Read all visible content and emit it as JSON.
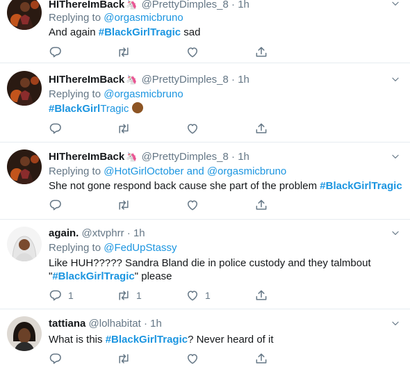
{
  "tweets": [
    {
      "name": "HIThereImBack",
      "handle": "@PrettyDimples_8",
      "time": "1h",
      "replying_label": "Replying to",
      "replying_to": "@orgasmicbruno",
      "body_pre": "And again ",
      "hashtag": "#BlackGirlTragic",
      "body_post": " sad",
      "reply_count": "",
      "retweet_count": "",
      "like_count": ""
    },
    {
      "name": "HIThereImBack",
      "handle": "@PrettyDimples_8",
      "time": "1h",
      "replying_label": "Replying to",
      "replying_to": "@orgasmicbruno",
      "hashtag_bold": "#BlackGirl",
      "hashtag_plain": "Tragic",
      "reply_count": "",
      "retweet_count": "",
      "like_count": ""
    },
    {
      "name": "HIThereImBack",
      "handle": "@PrettyDimples_8",
      "time": "1h",
      "replying_label": "Replying to",
      "replying_to": "@HotGirlOctober and @orgasmicbruno",
      "body_pre": "She not gone respond back cause she part of the problem ",
      "hashtag": "#BlackGirlTragic",
      "reply_count": "",
      "retweet_count": "",
      "like_count": ""
    },
    {
      "name": "again.",
      "handle": "@xtvphrr",
      "time": "1h",
      "replying_label": "Replying to",
      "replying_to": "@FedUpStassy",
      "body_line1": "Like HUH????? Sandra Bland die in police custody and they talmbout",
      "quote_open": "\"",
      "hashtag": "#BlackGirlTragic",
      "quote_close": "\" please",
      "reply_count": "1",
      "retweet_count": "1",
      "like_count": "1"
    },
    {
      "name": "tattiana",
      "handle": "@lolhabitat",
      "time": "1h",
      "body_pre": "What is this ",
      "hashtag": "#BlackGirlTragic",
      "body_post": "? Never heard of it",
      "reply_count": "",
      "retweet_count": "",
      "like_count": ""
    }
  ],
  "separator": "·",
  "icons": [
    "reply-icon",
    "retweet-icon",
    "like-icon",
    "share-icon",
    "caret-down-icon",
    "unicorn-emoji",
    "facepalm-emoji"
  ],
  "colors": {
    "link": "#1b95e0",
    "muted": "#657786",
    "border": "#e6ecf0"
  }
}
